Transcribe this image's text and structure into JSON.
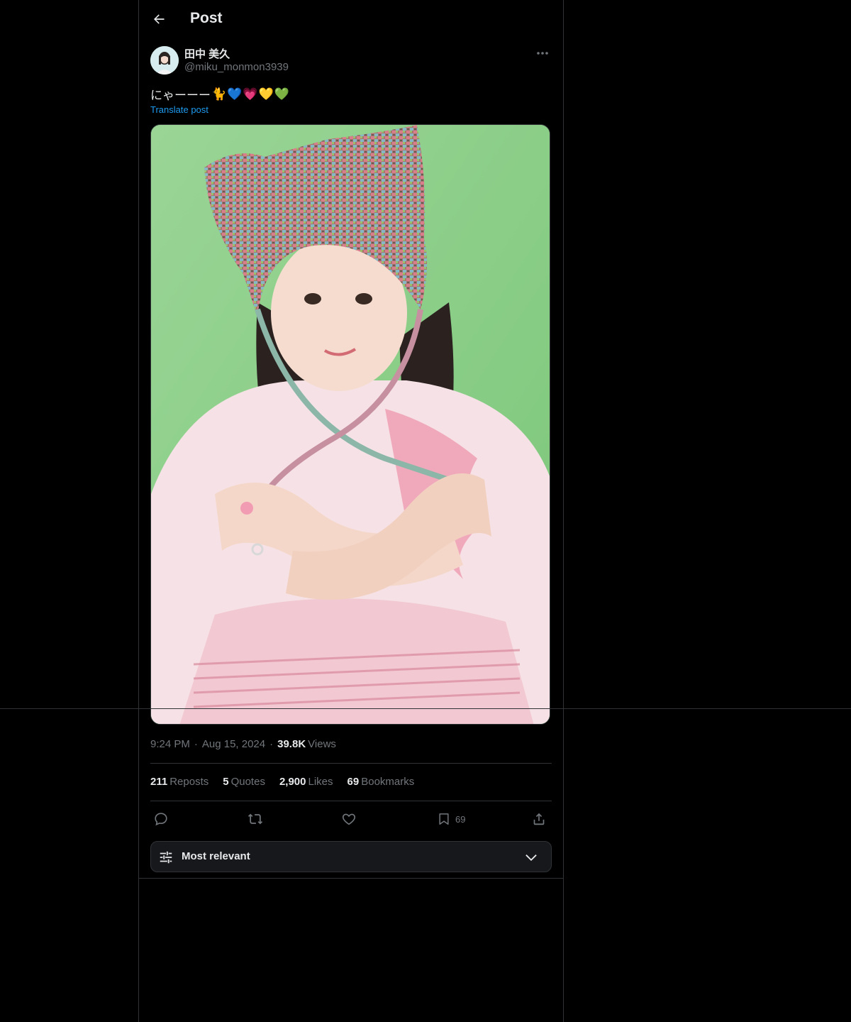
{
  "header": {
    "title": "Post",
    "back_icon": "arrow-left-icon"
  },
  "post": {
    "author_name": "田中 美久",
    "author_handle": "@miku_monmon3939",
    "text": "にゃーーー",
    "emojis": [
      "🐈",
      "💙",
      "💗",
      "💛",
      "💚"
    ],
    "translate_label": "Translate post",
    "media_alt": "Photo of a girl in a knit cat-ear hat and pink dress on green background",
    "time": "9:24 PM",
    "date": "Aug 15, 2024",
    "views_count": "39.8K",
    "views_label": "Views"
  },
  "stats": {
    "reposts_count": "211",
    "reposts_label": "Reposts",
    "quotes_count": "5",
    "quotes_label": "Quotes",
    "likes_count": "2,900",
    "likes_label": "Likes",
    "bookmarks_count": "69",
    "bookmarks_label": "Bookmarks"
  },
  "actions": {
    "bookmark_count": "69"
  },
  "sort": {
    "label": "Most relevant"
  },
  "colors": {
    "background": "#000000",
    "text": "#e7e9ea",
    "muted": "#71767b",
    "accent": "#1d9bf0",
    "border": "#2f3336"
  }
}
